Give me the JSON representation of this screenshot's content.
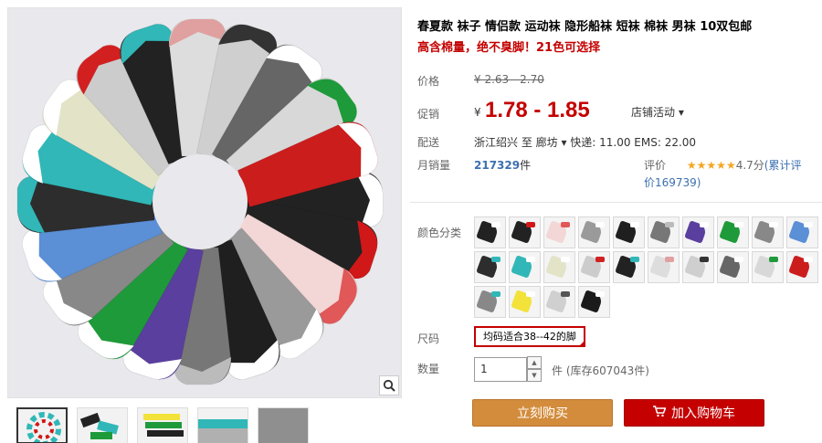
{
  "product": {
    "title": "春夏款 袜子 情侣款 运动袜 隐形船袜 短袜 棉袜 男袜 10双包邮",
    "subtitle": "高含棉量，绝不臭脚！21色可选择"
  },
  "price": {
    "label": "价格",
    "original": "¥ 2.63 - 2.70",
    "promo_label": "促销",
    "currency": "¥",
    "promo": "1.78 - 1.85",
    "store_activity": "店铺活动 ▾"
  },
  "shipping": {
    "label": "配送",
    "text": "浙江绍兴  至  廊坊 ▾  快递: 11.00 EMS: 22.00"
  },
  "sales": {
    "label": "月销量",
    "count": "217329",
    "unit": "件"
  },
  "rating": {
    "label": "评价",
    "stars": "★★★★★",
    "score": "4.7分",
    "link": "(累计评价169739)"
  },
  "color": {
    "label": "颜色分类",
    "swatches": [
      {
        "c": "#222222",
        "t": "#ffffff"
      },
      {
        "c": "#222222",
        "t": "#d01818"
      },
      {
        "c": "#f3d6d6",
        "t": "#e05858"
      },
      {
        "c": "#9a9a9a",
        "t": "#ffffff"
      },
      {
        "c": "#1f1f1f",
        "t": "#ffffff"
      },
      {
        "c": "#777777",
        "t": "#bbbbbb"
      },
      {
        "c": "#5a3f9e",
        "t": "#ffffff"
      },
      {
        "c": "#1e9a3a",
        "t": "#ffffff"
      },
      {
        "c": "#888888",
        "t": "#ffffff"
      },
      {
        "c": "#5b8fd6",
        "t": "#ffffff"
      },
      {
        "c": "#2d2d2d",
        "t": "#31b7b7"
      },
      {
        "c": "#31b7b7",
        "t": "#ffffff"
      },
      {
        "c": "#e3e3c8",
        "t": "#ffffff"
      },
      {
        "c": "#cccccc",
        "t": "#d22020"
      },
      {
        "c": "#222222",
        "t": "#31b7b7"
      },
      {
        "c": "#dddddd",
        "t": "#e0a0a0"
      },
      {
        "c": "#cfcfcf",
        "t": "#333333"
      },
      {
        "c": "#666666",
        "t": "#ffffff"
      },
      {
        "c": "#d8d8d8",
        "t": "#1e9a3a"
      },
      {
        "c": "#cc1d1d",
        "t": "#ffffff"
      },
      {
        "c": "#888888",
        "t": "#31b7b7"
      },
      {
        "c": "#f2e23a",
        "t": "#ffffff"
      },
      {
        "c": "#d0d0d0",
        "t": "#555555"
      },
      {
        "c": "#1b1b1b",
        "t": "#ffffff"
      }
    ]
  },
  "size": {
    "label": "尺码",
    "value": "均码适合38--42的脚"
  },
  "quantity": {
    "label": "数量",
    "value": "1",
    "unit_stock": "件 (库存607043件)"
  },
  "buttons": {
    "buy": "立刻购买",
    "cart": "加入购物车"
  },
  "icons": {
    "zoom": "magnifier-icon",
    "cart": "shopping-cart-icon"
  }
}
